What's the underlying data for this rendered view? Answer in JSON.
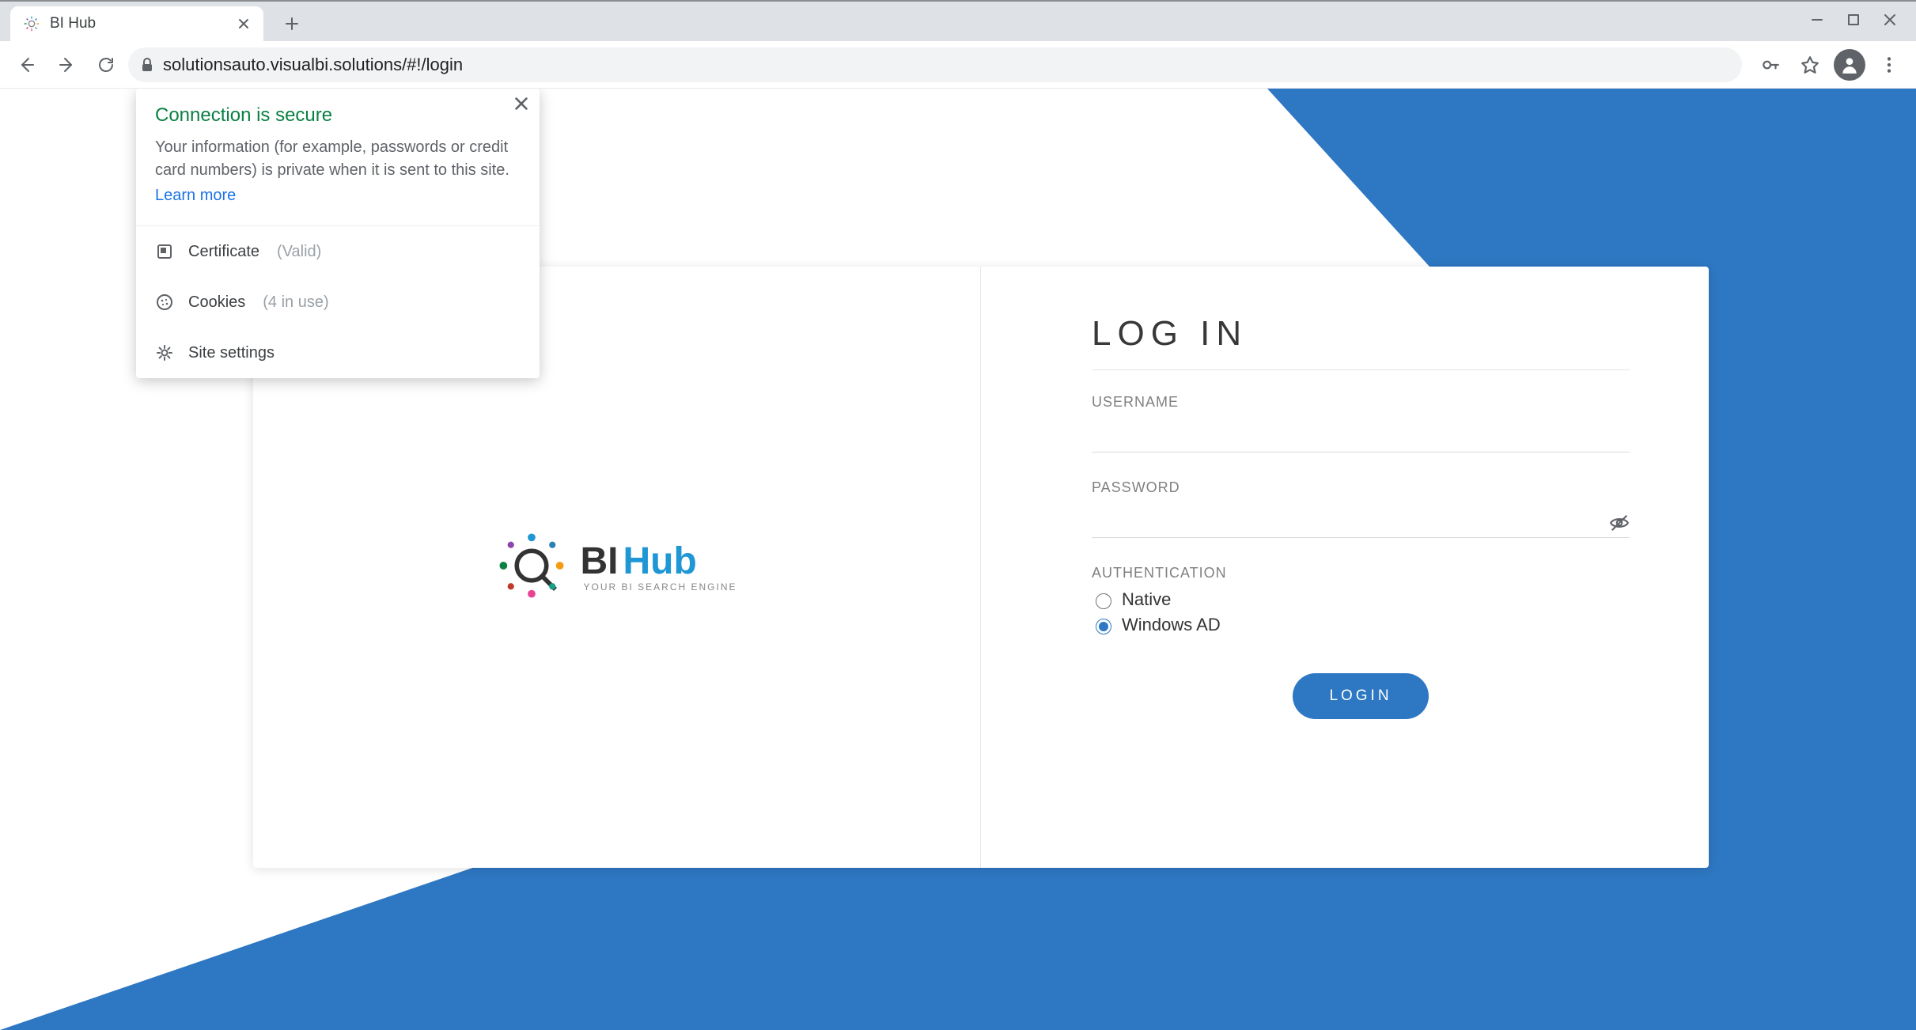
{
  "browser": {
    "tab_title": "BI Hub",
    "url": "solutionsauto.visualbi.solutions/#!/login"
  },
  "site_info": {
    "heading": "Connection is secure",
    "description": "Your information (for example, passwords or credit card numbers) is private when it is sent to this site.",
    "learn_more": "Learn more",
    "items": {
      "certificate_label": "Certificate",
      "certificate_status": "(Valid)",
      "cookies_label": "Cookies",
      "cookies_status": "(4 in use)",
      "site_settings_label": "Site settings"
    }
  },
  "logo": {
    "bi": "BI",
    "hub": "Hub",
    "tagline": "YOUR BI SEARCH ENGINE"
  },
  "login": {
    "title": "LOG IN",
    "username_label": "USERNAME",
    "password_label": "PASSWORD",
    "auth_label": "AUTHENTICATION",
    "options": {
      "native": "Native",
      "windows_ad": "Windows AD"
    },
    "selected_option": "windows_ad",
    "button": "LOGIN"
  }
}
